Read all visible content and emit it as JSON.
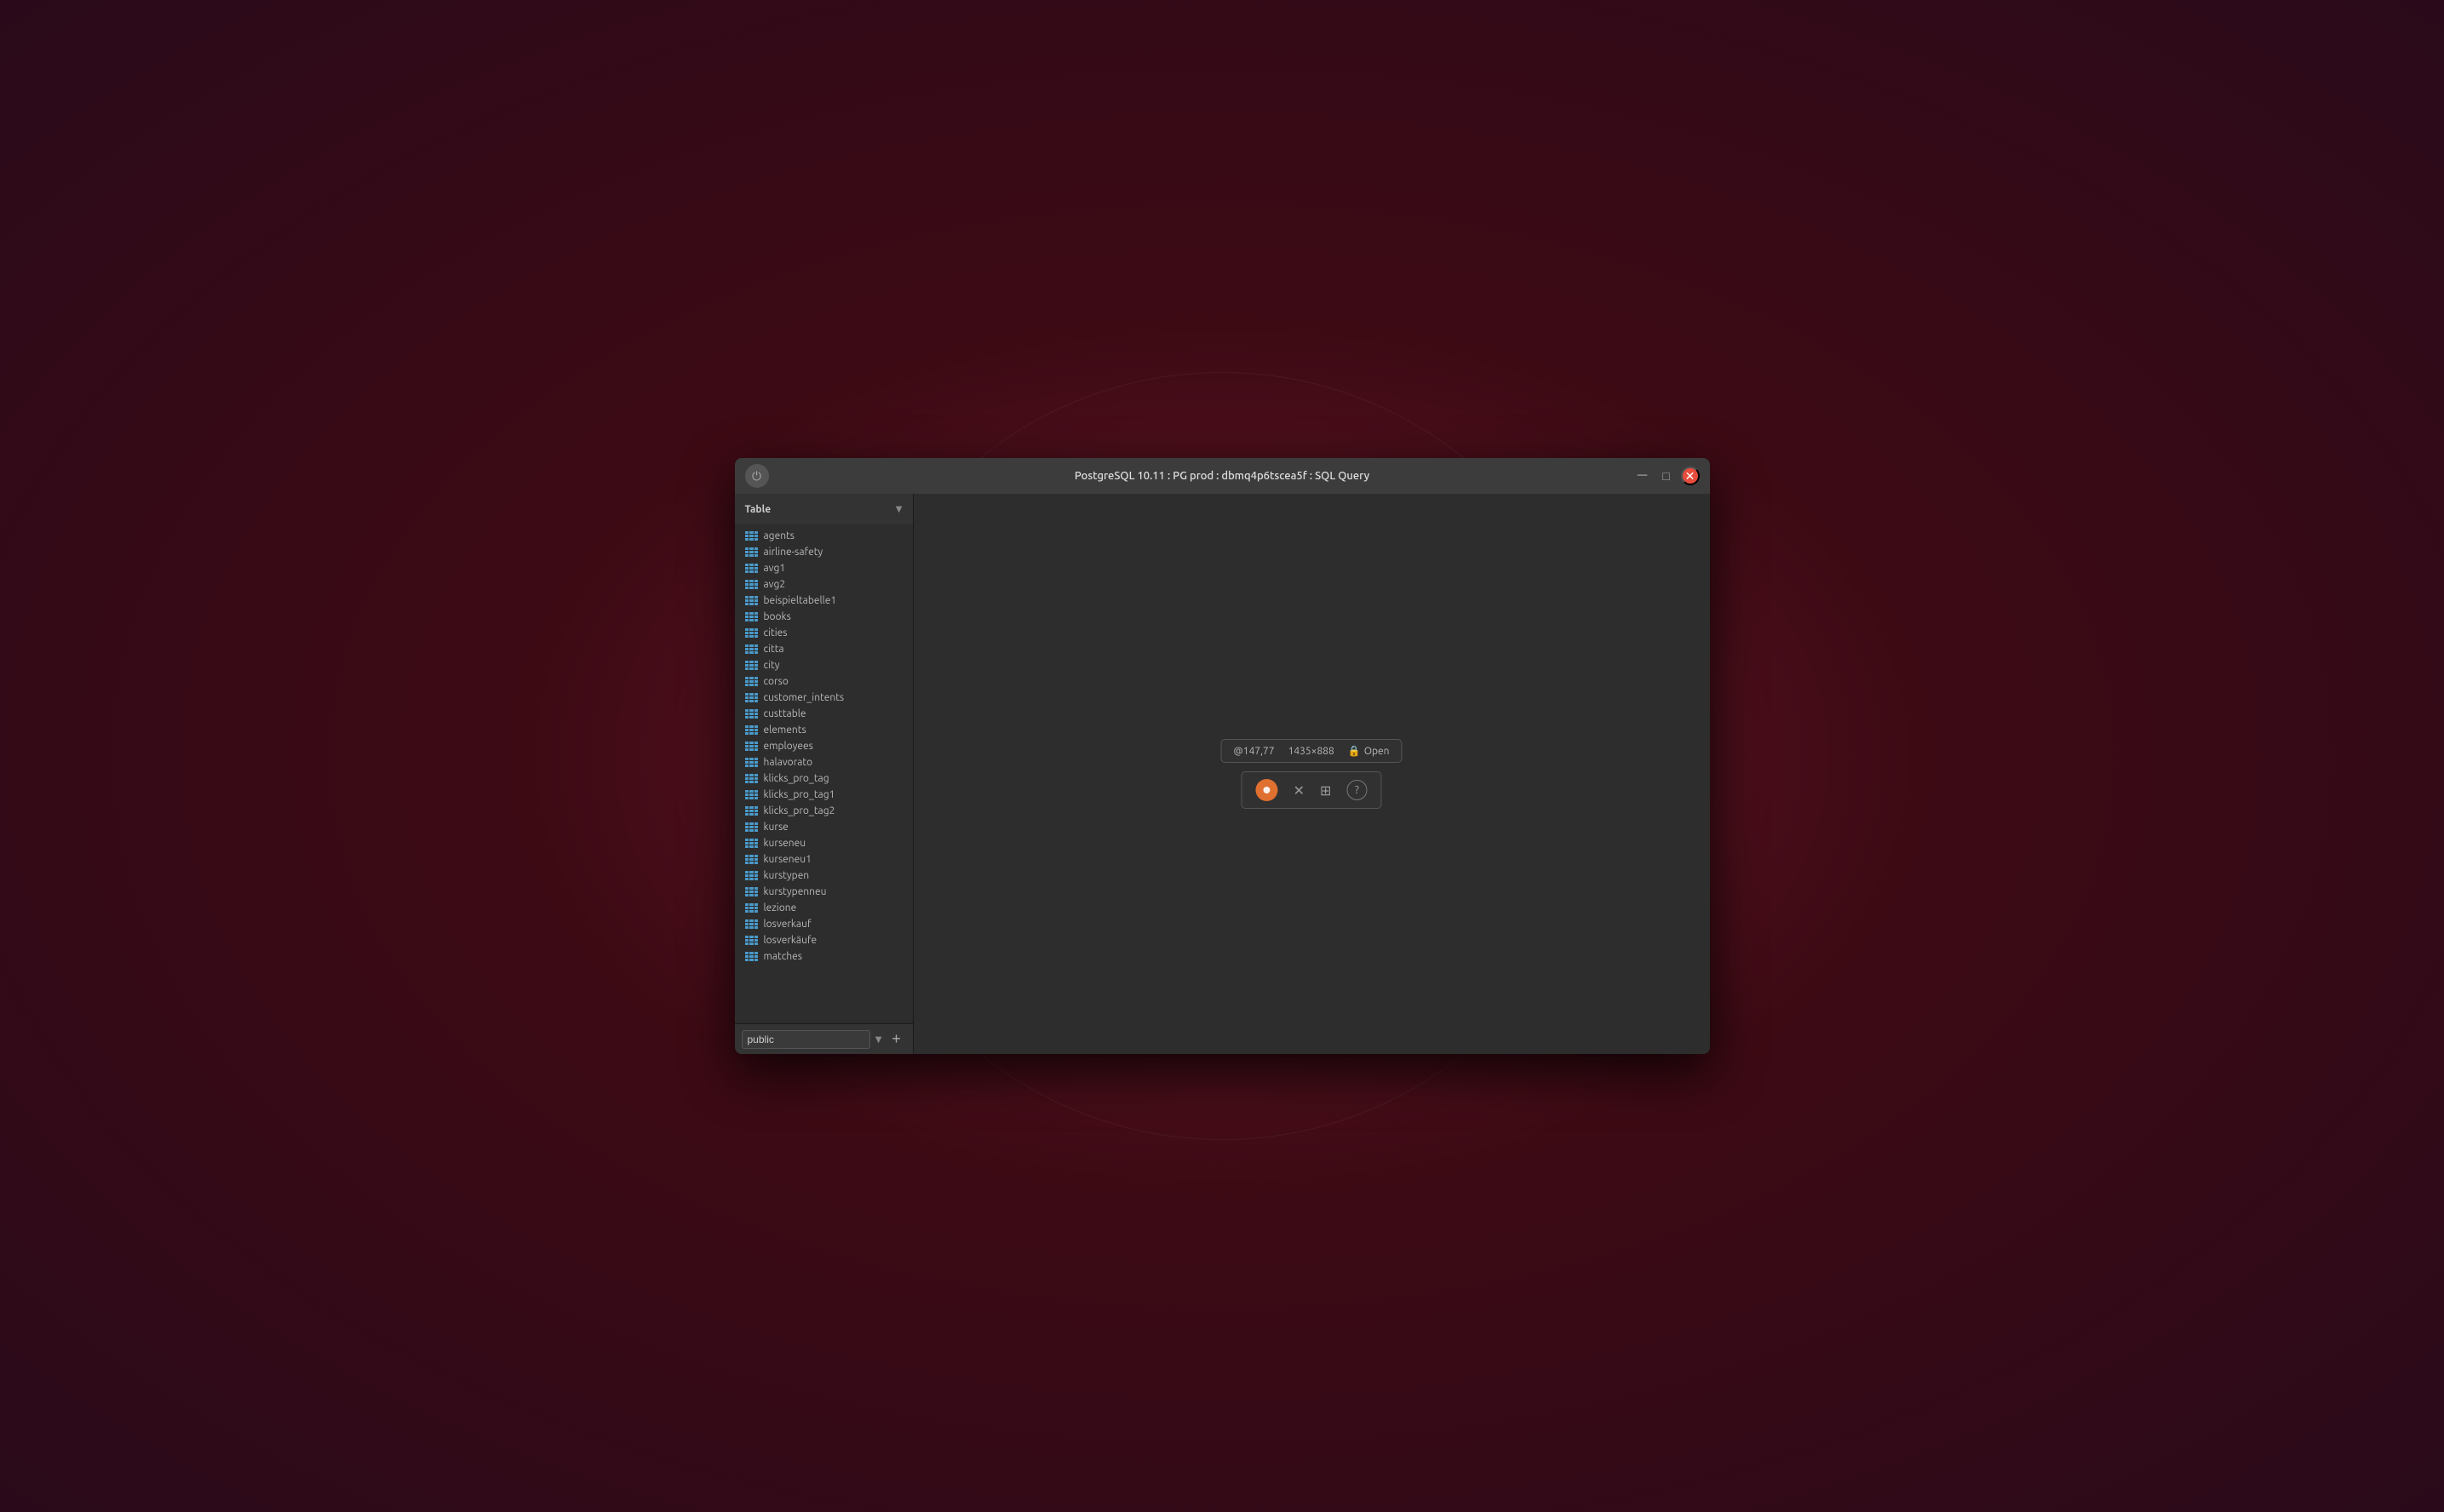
{
  "window": {
    "title": "PostgreSQL 10.11  :  PG prod  :  dbmq4p6tscea5f  :  SQL Query",
    "power_icon": "⏻",
    "minimize_icon": "─",
    "maximize_icon": "□",
    "close_icon": "✕"
  },
  "sidebar": {
    "header_label": "Table",
    "tables": [
      "agents",
      "airline-safety",
      "avg1",
      "avg2",
      "beispieltabelle1",
      "books",
      "cities",
      "citta",
      "city",
      "corso",
      "customer_intents",
      "custtable",
      "elements",
      "employees",
      "halavorato",
      "klicks_pro_tag",
      "klicks_pro_tag1",
      "klicks_pro_tag2",
      "kurse",
      "kurseneu",
      "kurseneu1",
      "kurstypen",
      "kurstypenneu",
      "lezione",
      "losverkauf",
      "losverkäufe",
      "matches"
    ],
    "schema": "public",
    "add_label": "+"
  },
  "tooltip": {
    "position": "@147,77",
    "size": "1435×888",
    "open_label": "Open",
    "lock_icon": "🔒"
  }
}
